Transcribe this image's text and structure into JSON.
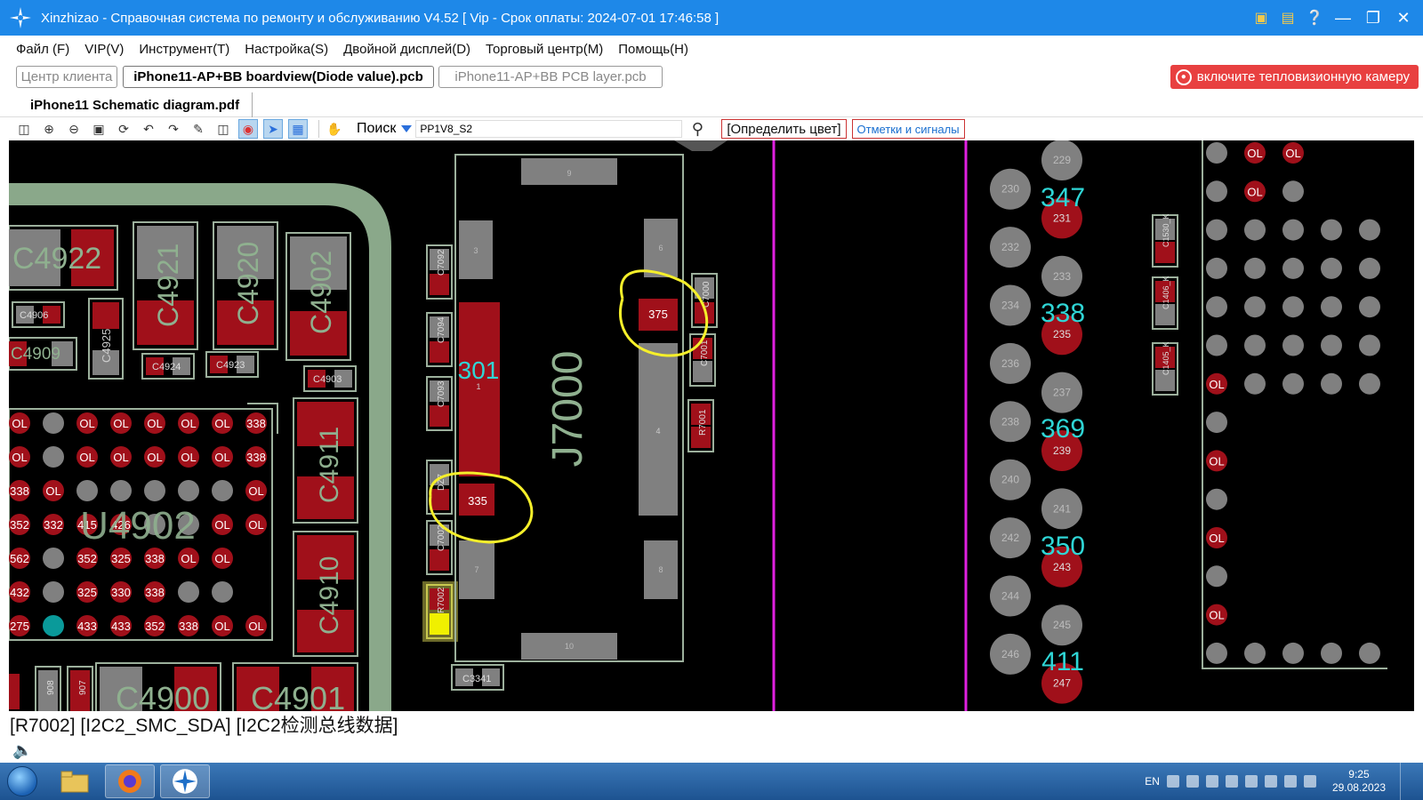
{
  "window": {
    "title": "Xinzhizao - Справочная система по ремонту и обслуживанию V4.52 [ Vip - Срок оплаты: 2024-07-01 17:46:58 ]"
  },
  "menu": [
    "Файл (F)",
    "VIP(V)",
    "Инструмент(T)",
    "Настройка(S)",
    "Двойной дисплей(D)",
    "Торговый центр(M)",
    "Помощь(H)"
  ],
  "tabs": {
    "client": "Центр клиента",
    "boardview": "iPhone11-AP+BB boardview(Diode value).pcb",
    "pcblayer": "iPhone11-AP+BB PCB layer.pcb",
    "thermal": "включите тепловизионную камеру"
  },
  "doc_tab": "iPhone11 Schematic diagram.pdf",
  "toolbar": {
    "search_label": "Поиск",
    "search_value": "PP1V8_S2",
    "color_button": "[Определить цвет]",
    "signals_button": "Отметки и сигналы"
  },
  "status": "[R7002] [I2C2_SMC_SDA] [I2C2检测总线数据]",
  "board": {
    "labels": {
      "c4922": "C4922",
      "c4921": "C4921",
      "c4920": "C4920",
      "c4902": "C4902",
      "c4906": "C4906",
      "c4925": "C4925",
      "c4909": "C4909",
      "c4924": "C4924",
      "c4923": "C4923",
      "c4903": "C4903",
      "c4911": "C4911",
      "c4910": "C4910",
      "u4902": "U4902",
      "c4900": "C4900",
      "c4901": "C4901",
      "c4908": "908",
      "c4907": "907",
      "c7092": "C7092",
      "c7094": "C7094",
      "c7093": "C7093",
      "dz7": "DZ7",
      "c7002": "C7002",
      "r7002": "R7002",
      "c3341": "C3341",
      "j7000": "J7000",
      "pad9": "9",
      "pad3": "3",
      "pad1": "1",
      "pad6": "6",
      "pad4": "4",
      "pad7": "7",
      "pad8": "8",
      "pad10": "10",
      "c7000": "C7000",
      "c7001": "C7001",
      "r7001": "R7001",
      "c1530": "C1530_K",
      "c1406": "C1406_K",
      "c1405": "C1405_K"
    },
    "diode_values": {
      "pad_301": "301",
      "pad_375": "375",
      "pad_335": "335",
      "right_347": "347",
      "right_338": "338",
      "right_369": "369",
      "right_350": "350",
      "right_411": "411"
    },
    "ball_grid_left": [
      [
        "OL",
        "",
        "OL",
        "OL",
        "OL",
        "OL",
        "OL",
        "338"
      ],
      [
        "OL",
        "",
        "OL",
        "OL",
        "OL",
        "OL",
        "OL",
        "338"
      ],
      [
        "338",
        "OL",
        "",
        "",
        "",
        "",
        "",
        "OL"
      ],
      [
        "352",
        "332",
        "415",
        "426",
        "",
        "",
        "OL",
        "OL"
      ],
      [
        "562",
        "",
        "352",
        "325",
        "338",
        "OL",
        "OL"
      ],
      [
        "432",
        "",
        "325",
        "330",
        "338",
        "",
        ""
      ],
      [
        "275",
        "",
        "433",
        "433",
        "352",
        "338",
        "OL",
        "OL"
      ]
    ],
    "pad_numbers_right": [
      "229",
      "230",
      "231",
      "232",
      "233",
      "234",
      "235",
      "236",
      "237",
      "238",
      "239",
      "240",
      "241",
      "242",
      "243",
      "244",
      "245",
      "246",
      "247"
    ],
    "ol_right": "OL"
  },
  "taskbar": {
    "lang": "EN",
    "time": "9:25",
    "date": "29.08.2023"
  }
}
